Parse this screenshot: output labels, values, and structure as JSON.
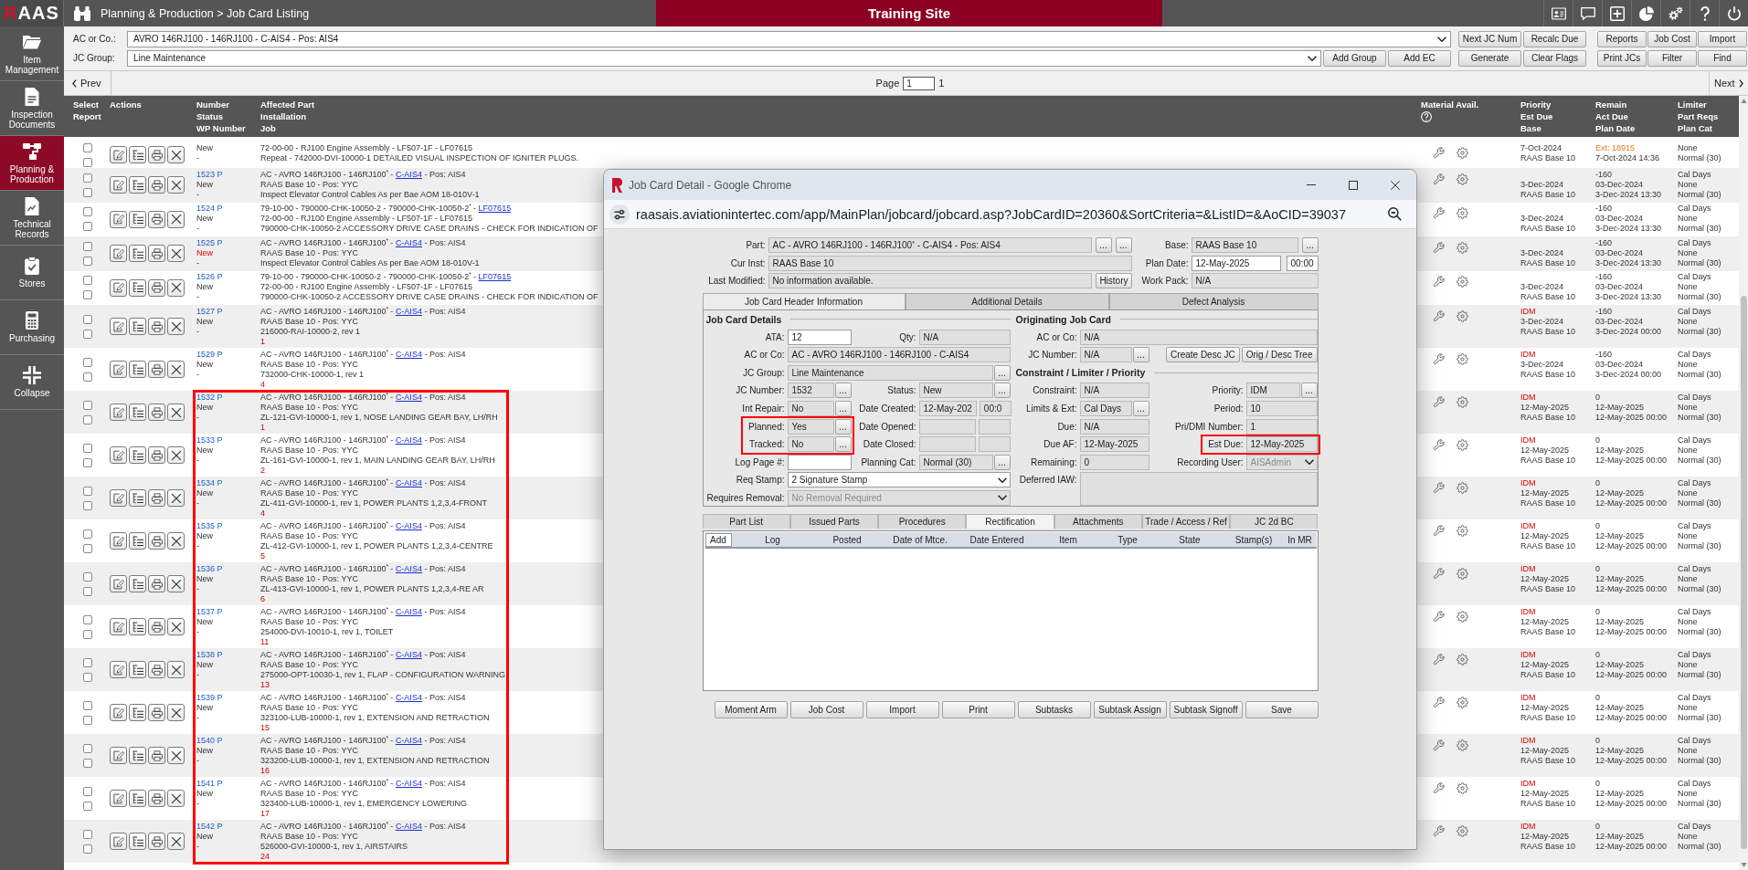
{
  "top_bar": {
    "logo": "RAAS",
    "breadcrumb": "Planning & Production > Job Card Listing",
    "site": "Training Site"
  },
  "sidebar": {
    "items": [
      {
        "label": "Item Management",
        "selected": false
      },
      {
        "label": "Inspection Documents",
        "selected": false
      },
      {
        "label": "Planning & Production",
        "selected": true
      },
      {
        "label": "Technical Records",
        "selected": false
      },
      {
        "label": "Stores",
        "selected": false
      },
      {
        "label": "Purchasing",
        "selected": false
      },
      {
        "label": "Collapse",
        "selected": false
      }
    ]
  },
  "filters": {
    "fields": [
      {
        "label": "AC or Co.:",
        "value": "AVRO 146RJ100 - 146RJ100 - C-AIS4 - Pos: AIS4"
      },
      {
        "label": "JC Group:",
        "value": "Line Maintenance"
      }
    ],
    "group_buttons": [
      "Add Group",
      "Add EC"
    ],
    "button_blocks": [
      [
        "Next JC Num",
        "Recalc Due",
        "Generate",
        "Clear Flags"
      ],
      [
        "Reports",
        "Job Cost",
        "Import",
        "Print JCs",
        "Filter",
        "Find"
      ]
    ]
  },
  "pager": {
    "prev": "Prev",
    "page_label": "Page",
    "page": "1",
    "page_count": "1",
    "next": "Next"
  },
  "table": {
    "columns": [
      {
        "labels": [
          "Select",
          "Report"
        ],
        "help": false
      },
      {
        "labels": [
          "Actions"
        ],
        "help": false
      },
      {
        "labels": [
          "Number",
          "Status",
          "WP Number"
        ],
        "help": false
      },
      {
        "labels": [
          "Affected Part",
          "Installation",
          "Job"
        ],
        "help": false
      },
      {
        "labels": [
          "Material Avail."
        ],
        "help": true
      },
      {
        "labels": [
          "Priority",
          "Est Due",
          "Base"
        ],
        "help": false
      },
      {
        "labels": [
          "Remain",
          "Act Due",
          "Plan Date"
        ],
        "help": false
      },
      {
        "labels": [
          "Limiter",
          "Part Reqs",
          "Plan Cat"
        ],
        "help": false
      }
    ],
    "partial_row": {
      "checks": [
        false,
        false
      ],
      "status": {
        "text": "New",
        "alert": false
      },
      "wp": "-",
      "installation": "72-00-00 - RJ100 Engine Assembly - LF507-1F - LF07615",
      "job": "Repeat - 742000-DVI-10000-1 DETAILED VISUAL INSPECTION OF IGNITER PLUGS.",
      "est_due": "7-Oct-2024",
      "base": "RAAS Base 10",
      "act_due": "Ext: 18915",
      "extended": true,
      "plan_date": "7-Oct-2024 14:36",
      "part_reqs": "None",
      "plan_cat": "Normal (30)"
    },
    "rows": [
      {
        "checks": [
          false,
          false
        ],
        "number": "1523 P",
        "status": {
          "text": "New",
          "alert": false
        },
        "wp": "-",
        "part": [
          {
            "kind": "text",
            "text": "AC - AVRO 146RJ100 - 146RJ100$^{*}$ -"
          },
          {
            "kind": "link",
            "text": "C-AIS4"
          },
          {
            "kind": "text",
            "text": "- Pos: AIS4"
          }
        ],
        "installation": "RAAS Base 10 - Pos: YYC",
        "job": "Inspect Elevator Control Cables As per Bae AOM 18-010V-1",
        "est_due": "3-Dec-2024",
        "base": "RAAS Base 10",
        "remain": "-160",
        "act_due": "03-Dec-2024",
        "extended": false,
        "plan_date": "3-Dec-2024 13:30",
        "limiter": "Cal Days",
        "part_reqs": "None",
        "plan_cat": "Normal (30)",
        "highlighted": false
      },
      {
        "checks": [
          false,
          false
        ],
        "number": "1524 P",
        "status": {
          "text": "New",
          "alert": false
        },
        "wp": "-",
        "part": [
          {
            "kind": "text",
            "text": "79-10-00 - 790000-CHK-10050-2 - 790000-CHK-10050-2$^{*}$ -"
          },
          {
            "kind": "link",
            "text": "LF07615"
          }
        ],
        "installation": "72-00-00 - RJ100 Engine Assembly - LF507-1F - LF07615",
        "job": "790000-CHK-10050-2 ACCESSORY DRIVE CASE DRAINS - CHECK FOR INDICATION OF",
        "est_due": "3-Dec-2024",
        "base": "RAAS Base 10",
        "remain": "-160",
        "act_due": "03-Dec-2024",
        "extended": false,
        "plan_date": "3-Dec-2024 13:30",
        "limiter": "Cal Days",
        "part_reqs": "None",
        "plan_cat": "Normal (30)",
        "highlighted": false
      },
      {
        "checks": [
          false,
          false
        ],
        "number": "1525 P",
        "status": {
          "text": "New",
          "alert": true
        },
        "wp": "-",
        "part": [
          {
            "kind": "text",
            "text": "AC - AVRO 146RJ100 - 146RJ100$^{*}$ -"
          },
          {
            "kind": "link",
            "text": "C-AIS4"
          },
          {
            "kind": "text",
            "text": "- Pos: AIS4"
          }
        ],
        "installation": "RAAS Base 10 - Pos: YYC",
        "job": "Inspect Elevator Control Cables As per Bae AOM 18-010V-1",
        "est_due": "3-Dec-2024",
        "base": "RAAS Base 10",
        "remain": "-160",
        "act_due": "03-Dec-2024",
        "extended": false,
        "plan_date": "3-Dec-2024 13:30",
        "limiter": "Cal Days",
        "part_reqs": "None",
        "plan_cat": "Normal (30)",
        "highlighted": false
      },
      {
        "checks": [
          false,
          false
        ],
        "number": "1526 P",
        "status": {
          "text": "New",
          "alert": false
        },
        "wp": "-",
        "part": [
          {
            "kind": "text",
            "text": "79-10-00 - 790000-CHK-10050-2 - 790000-CHK-10050-2$^{*}$ -"
          },
          {
            "kind": "link",
            "text": "LF07615"
          }
        ],
        "installation": "72-00-00 - RJ100 Engine Assembly - LF507-1F - LF07615",
        "job": "790000-CHK-10050-2 ACCESSORY DRIVE CASE DRAINS - CHECK FOR INDICATION OF",
        "est_due": "3-Dec-2024",
        "base": "RAAS Base 10",
        "remain": "-160",
        "act_due": "03-Dec-2024",
        "extended": false,
        "plan_date": "3-Dec-2024 13:30",
        "limiter": "Cal Days",
        "part_reqs": "None",
        "plan_cat": "Normal (30)",
        "highlighted": false
      },
      {
        "checks": [
          false,
          false
        ],
        "number": "1527 P",
        "status": {
          "text": "New",
          "alert": false
        },
        "wp": "-",
        "part": [
          {
            "kind": "text",
            "text": "AC - AVRO 146RJ100 - 146RJ100$^{*}$ -"
          },
          {
            "kind": "link",
            "text": "C-AIS4"
          },
          {
            "kind": "text",
            "text": "- Pos: AIS4"
          }
        ],
        "installation": "RAAS Base 10 - Pos: YYC",
        "job": "216000-RAI-10000-2, rev 1",
        "seq": "1",
        "priority": "IDM",
        "est_due": "3-Dec-2024",
        "base": "RAAS Base 10",
        "remain": "-160",
        "act_due": "03-Dec-2024",
        "extended": false,
        "plan_date": "3-Dec-2024 00:00",
        "limiter": "Cal Days",
        "part_reqs": "None",
        "plan_cat": "Normal (30)",
        "highlighted": false
      },
      {
        "checks": [
          false,
          false
        ],
        "number": "1529 P",
        "status": {
          "text": "New",
          "alert": false
        },
        "wp": "-",
        "part": [
          {
            "kind": "text",
            "text": "AC - AVRO 146RJ100 - 146RJ100$^{*}$ -"
          },
          {
            "kind": "link",
            "text": "C-AIS4"
          },
          {
            "kind": "text",
            "text": "- Pos: AIS4"
          }
        ],
        "installation": "RAAS Base 10 - Pos: YYC",
        "job": "732000-CHK-10000-1, rev 1",
        "seq": "4",
        "priority": "IDM",
        "est_due": "3-Dec-2024",
        "base": "RAAS Base 10",
        "remain": "-160",
        "act_due": "03-Dec-2024",
        "extended": false,
        "plan_date": "3-Dec-2024 00:00",
        "limiter": "Cal Days",
        "part_reqs": "None",
        "plan_cat": "Normal (30)",
        "highlighted": false
      },
      {
        "checks": [
          false,
          false
        ],
        "number": "1532 P",
        "status": {
          "text": "New",
          "alert": false
        },
        "wp": "-",
        "part": [
          {
            "kind": "text",
            "text": "AC - AVRO 146RJ100 - 146RJ100$^{*}$ -"
          },
          {
            "kind": "link",
            "text": "C-AIS4"
          },
          {
            "kind": "text",
            "text": "- Pos: AIS4"
          }
        ],
        "installation": "RAAS Base 10 - Pos: YYC",
        "job": "ZL-121-GVI-10000-1, rev 1, NOSE LANDING GEAR BAY, LH/RH",
        "seq": "1",
        "priority": "IDM",
        "est_due": "12-May-2025",
        "base": "RAAS Base 10",
        "remain": "0",
        "act_due": "12-May-2025",
        "extended": false,
        "plan_date": "12-May-2025 00:00",
        "limiter": "Cal Days",
        "part_reqs": "None",
        "plan_cat": "Normal (30)",
        "highlighted": true
      },
      {
        "checks": [
          false,
          false
        ],
        "number": "1533 P",
        "status": {
          "text": "New",
          "alert": false
        },
        "wp": "-",
        "part": [
          {
            "kind": "text",
            "text": "AC - AVRO 146RJ100 - 146RJ100$^{*}$ -"
          },
          {
            "kind": "link",
            "text": "C-AIS4"
          },
          {
            "kind": "text",
            "text": "- Pos: AIS4"
          }
        ],
        "installation": "RAAS Base 10 - Pos: YYC",
        "job": "ZL-161-GVI-10000-1, rev 1, MAIN LANDING GEAR BAY, LH/RH",
        "seq": "2",
        "priority": "IDM",
        "est_due": "12-May-2025",
        "base": "RAAS Base 10",
        "remain": "0",
        "act_due": "12-May-2025",
        "extended": false,
        "plan_date": "12-May-2025 00:00",
        "limiter": "Cal Days",
        "part_reqs": "None",
        "plan_cat": "Normal (30)",
        "highlighted": true
      },
      {
        "checks": [
          false,
          false
        ],
        "number": "1534 P",
        "status": {
          "text": "New",
          "alert": false
        },
        "wp": "-",
        "part": [
          {
            "kind": "text",
            "text": "AC - AVRO 146RJ100 - 146RJ100$^{*}$ -"
          },
          {
            "kind": "link",
            "text": "C-AIS4"
          },
          {
            "kind": "text",
            "text": "- Pos: AIS4"
          }
        ],
        "installation": "RAAS Base 10 - Pos: YYC",
        "job": "ZL-411-GVI-10000-1, rev 1, POWER PLANTS 1,2,3,4-FRONT",
        "seq": "4",
        "priority": "IDM",
        "est_due": "12-May-2025",
        "base": "RAAS Base 10",
        "remain": "0",
        "act_due": "12-May-2025",
        "extended": false,
        "plan_date": "12-May-2025 00:00",
        "limiter": "Cal Days",
        "part_reqs": "None",
        "plan_cat": "Normal (30)",
        "highlighted": true
      },
      {
        "checks": [
          false,
          false
        ],
        "number": "1535 P",
        "status": {
          "text": "New",
          "alert": false
        },
        "wp": "-",
        "part": [
          {
            "kind": "text",
            "text": "AC - AVRO 146RJ100 - 146RJ100$^{*}$ -"
          },
          {
            "kind": "link",
            "text": "C-AIS4"
          },
          {
            "kind": "text",
            "text": "- Pos: AIS4"
          }
        ],
        "installation": "RAAS Base 10 - Pos: YYC",
        "job": "ZL-412-GVI-10000-1, rev 1, POWER PLANTS 1,2,3,4-CENTRE",
        "seq": "5",
        "priority": "IDM",
        "est_due": "12-May-2025",
        "base": "RAAS Base 10",
        "remain": "0",
        "act_due": "12-May-2025",
        "extended": false,
        "plan_date": "12-May-2025 00:00",
        "limiter": "Cal Days",
        "part_reqs": "None",
        "plan_cat": "Normal (30)",
        "highlighted": true
      },
      {
        "checks": [
          false,
          false
        ],
        "number": "1536 P",
        "status": {
          "text": "New",
          "alert": false
        },
        "wp": "-",
        "part": [
          {
            "kind": "text",
            "text": "AC - AVRO 146RJ100 - 146RJ100$^{*}$ -"
          },
          {
            "kind": "link",
            "text": "C-AIS4"
          },
          {
            "kind": "text",
            "text": "- Pos: AIS4"
          }
        ],
        "installation": "RAAS Base 10 - Pos: YYC",
        "job": "ZL-413-GVI-10000-1, rev 1, POWER PLANTS 1,2,3,4-RE AR",
        "seq": "6",
        "priority": "IDM",
        "est_due": "12-May-2025",
        "base": "RAAS Base 10",
        "remain": "0",
        "act_due": "12-May-2025",
        "extended": false,
        "plan_date": "12-May-2025 00:00",
        "limiter": "Cal Days",
        "part_reqs": "None",
        "plan_cat": "Normal (30)",
        "highlighted": true
      },
      {
        "checks": [
          false,
          false
        ],
        "number": "1537 P",
        "status": {
          "text": "New",
          "alert": false
        },
        "wp": "-",
        "part": [
          {
            "kind": "text",
            "text": "AC - AVRO 146RJ100 - 146RJ100$^{*}$ -"
          },
          {
            "kind": "link",
            "text": "C-AIS4"
          },
          {
            "kind": "text",
            "text": "- Pos: AIS4"
          }
        ],
        "installation": "RAAS Base 10 - Pos: YYC",
        "job": "254000-DVI-10010-1, rev 1, TOILET",
        "seq": "11",
        "priority": "IDM",
        "est_due": "12-May-2025",
        "base": "RAAS Base 10",
        "remain": "0",
        "act_due": "12-May-2025",
        "extended": false,
        "plan_date": "12-May-2025 00:00",
        "limiter": "Cal Days",
        "part_reqs": "None",
        "plan_cat": "Normal (30)",
        "highlighted": true
      },
      {
        "checks": [
          false,
          false
        ],
        "number": "1538 P",
        "status": {
          "text": "New",
          "alert": false
        },
        "wp": "-",
        "part": [
          {
            "kind": "text",
            "text": "AC - AVRO 146RJ100 - 146RJ100$^{*}$ -"
          },
          {
            "kind": "link",
            "text": "C-AIS4"
          },
          {
            "kind": "text",
            "text": "- Pos: AIS4"
          }
        ],
        "installation": "RAAS Base 10 - Pos: YYC",
        "job": "275000-OPT-10030-1, rev 1, FLAP - CONFIGURATION WARNING",
        "seq": "13",
        "priority": "IDM",
        "est_due": "12-May-2025",
        "base": "RAAS Base 10",
        "remain": "0",
        "act_due": "12-May-2025",
        "extended": false,
        "plan_date": "12-May-2025 00:00",
        "limiter": "Cal Days",
        "part_reqs": "None",
        "plan_cat": "Normal (30)",
        "highlighted": true
      },
      {
        "checks": [
          false,
          false
        ],
        "number": "1539 P",
        "status": {
          "text": "New",
          "alert": false
        },
        "wp": "-",
        "part": [
          {
            "kind": "text",
            "text": "AC - AVRO 146RJ100 - 146RJ100$^{*}$ -"
          },
          {
            "kind": "link",
            "text": "C-AIS4"
          },
          {
            "kind": "text",
            "text": "- Pos: AIS4"
          }
        ],
        "installation": "RAAS Base 10 - Pos: YYC",
        "job": "323100-LUB-10000-1, rev 1, EXTENSION AND RETRACTION",
        "seq": "15",
        "priority": "IDM",
        "est_due": "12-May-2025",
        "base": "RAAS Base 10",
        "remain": "0",
        "act_due": "12-May-2025",
        "extended": false,
        "plan_date": "12-May-2025 00:00",
        "limiter": "Cal Days",
        "part_reqs": "None",
        "plan_cat": "Normal (30)",
        "highlighted": true
      },
      {
        "checks": [
          false,
          false
        ],
        "number": "1540 P",
        "status": {
          "text": "New",
          "alert": false
        },
        "wp": "-",
        "part": [
          {
            "kind": "text",
            "text": "AC - AVRO 146RJ100 - 146RJ100$^{*}$ -"
          },
          {
            "kind": "link",
            "text": "C-AIS4"
          },
          {
            "kind": "text",
            "text": "- Pos: AIS4"
          }
        ],
        "installation": "RAAS Base 10 - Pos: YYC",
        "job": "323200-LUB-10000-1, rev 1, EXTENSION AND RETRACTION",
        "seq": "16",
        "priority": "IDM",
        "est_due": "12-May-2025",
        "base": "RAAS Base 10",
        "remain": "0",
        "act_due": "12-May-2025",
        "extended": false,
        "plan_date": "12-May-2025 00:00",
        "limiter": "Cal Days",
        "part_reqs": "None",
        "plan_cat": "Normal (30)",
        "highlighted": true
      },
      {
        "checks": [
          false,
          false
        ],
        "number": "1541 P",
        "status": {
          "text": "New",
          "alert": false
        },
        "wp": "-",
        "part": [
          {
            "kind": "text",
            "text": "AC - AVRO 146RJ100 - 146RJ100$^{*}$ -"
          },
          {
            "kind": "link",
            "text": "C-AIS4"
          },
          {
            "kind": "text",
            "text": "- Pos: AIS4"
          }
        ],
        "installation": "RAAS Base 10 - Pos: YYC",
        "job": "323400-LUB-10000-1, rev 1, EMERGENCY LOWERING",
        "seq": "17",
        "priority": "IDM",
        "est_due": "12-May-2025",
        "base": "RAAS Base 10",
        "remain": "0",
        "act_due": "12-May-2025",
        "extended": false,
        "plan_date": "12-May-2025 00:00",
        "limiter": "Cal Days",
        "part_reqs": "None",
        "plan_cat": "Normal (30)",
        "highlighted": true
      },
      {
        "checks": [
          false,
          false
        ],
        "number": "1542 P",
        "status": {
          "text": "New",
          "alert": false
        },
        "wp": "-",
        "part": [
          {
            "kind": "text",
            "text": "AC - AVRO 146RJ100 - 146RJ100$^{*}$ -"
          },
          {
            "kind": "link",
            "text": "C-AIS4"
          },
          {
            "kind": "text",
            "text": "- Pos: AIS4"
          }
        ],
        "installation": "RAAS Base 10 - Pos: YYC",
        "job": "526000-GVI-10000-1, rev 1, AIRSTAIRS",
        "seq": "24",
        "priority": "IDM",
        "est_due": "12-May-2025",
        "base": "RAAS Base 10",
        "remain": "0",
        "act_due": "12-May-2025",
        "extended": false,
        "plan_date": "12-May-2025 00:00",
        "limiter": "Cal Days",
        "part_reqs": "None",
        "plan_cat": "Normal (30)",
        "highlighted": true
      }
    ]
  },
  "dialog": {
    "title": "Job Card Detail - Google Chrome",
    "url": "raasais.aviationintertec.com/app/MainPlan/jobcard/jobcard.asp?JobCardID=20360&SortCriteria=&ListID=&AoCID=39037",
    "header": {
      "left": [
        {
          "label": "Part:",
          "kind": "readonly",
          "value": "AC - AVRO 146RJ100 - 146RJ100$^{*}$ - C-AIS4 - Pos: AIS4",
          "lookups": [
            "...",
            "..."
          ]
        },
        {
          "label": "Cur Inst:",
          "kind": "readonly",
          "value": "RAAS Base 10"
        },
        {
          "label": "Last Modified:",
          "kind": "readonly",
          "value": "No information available.",
          "action": "History"
        }
      ],
      "right": [
        {
          "label": "Base:",
          "kind": "readonly",
          "value": "RAAS Base 10",
          "lookups": [
            "..."
          ]
        },
        {
          "label": "Plan Date:",
          "kind": "input-datetime",
          "value": "12-May-2025",
          "time": "00:00"
        },
        {
          "label": "Work Pack:",
          "kind": "readonly",
          "value": "N/A"
        }
      ]
    },
    "tabs": [
      {
        "label": "Job Card Header Information",
        "selected": true
      },
      {
        "label": "Additional Details",
        "selected": false
      },
      {
        "label": "Defect Analysis",
        "selected": false
      }
    ],
    "panel": {
      "columns": [
        {
          "items": [
            {
              "kind": "heading",
              "text": "Job Card Details"
            },
            {
              "kind": "row",
              "fields": [
                {
                  "label": "ATA:",
                  "kind": "input",
                  "value": "12",
                  "highlighted": false
                },
                {
                  "label": "Qty:",
                  "kind": "readonly",
                  "value": "N/A",
                  "highlighted": false
                }
              ]
            },
            {
              "kind": "row",
              "fields": [
                {
                  "label": "AC or Co:",
                  "kind": "readonly",
                  "value": "AC - AVRO 146RJ100 - 146RJ100 - C-AIS4",
                  "highlighted": false
                }
              ]
            },
            {
              "kind": "row",
              "fields": [
                {
                  "label": "JC Group:",
                  "kind": "readonly",
                  "value": "Line Maintenance",
                  "lookups": [
                    "..."
                  ],
                  "highlighted": false
                }
              ]
            },
            {
              "kind": "row",
              "fields": [
                {
                  "label": "JC Number:",
                  "kind": "readonly",
                  "value": "1532",
                  "lookups": [
                    "..."
                  ],
                  "highlighted": false
                },
                {
                  "label": "Status:",
                  "kind": "readonly",
                  "value": "New",
                  "lookups": [
                    "..."
                  ],
                  "highlighted": false
                }
              ]
            },
            {
              "kind": "row",
              "fields": [
                {
                  "label": "Int Repair:",
                  "kind": "readonly",
                  "value": "No",
                  "lookups": [
                    "..."
                  ],
                  "highlighted": false
                },
                {
                  "label": "Date Created:",
                  "kind": "readonly-datetime",
                  "value": "12-May-202",
                  "time": "00:0",
                  "highlighted": false
                }
              ]
            },
            {
              "kind": "row",
              "fields": [
                {
                  "label": "Planned:",
                  "kind": "readonly",
                  "value": "Yes",
                  "lookups": [
                    "..."
                  ],
                  "highlighted": true
                },
                {
                  "label": "Date Opened:",
                  "kind": "readonly-datetime",
                  "highlighted": false
                }
              ]
            },
            {
              "kind": "row",
              "fields": [
                {
                  "label": "Tracked:",
                  "kind": "readonly",
                  "value": "No",
                  "lookups": [
                    "..."
                  ],
                  "highlighted": true
                },
                {
                  "label": "Date Closed:",
                  "kind": "readonly-datetime",
                  "highlighted": false
                }
              ]
            },
            {
              "kind": "row",
              "fields": [
                {
                  "label": "Log Page #:",
                  "kind": "input",
                  "highlighted": false
                },
                {
                  "label": "Planning Cat:",
                  "kind": "readonly",
                  "value": "Normal (30)",
                  "lookups": [
                    "..."
                  ],
                  "highlighted": false
                }
              ]
            },
            {
              "kind": "row",
              "fields": [
                {
                  "label": "Req Stamp:",
                  "kind": "select",
                  "value": "2 Signature Stamp",
                  "highlighted": false
                }
              ]
            },
            {
              "kind": "row",
              "fields": [
                {
                  "label": "Requires Removal:",
                  "kind": "disabled-select",
                  "value": "No Removal Required",
                  "highlighted": false
                }
              ]
            }
          ]
        },
        {
          "items": [
            {
              "kind": "heading",
              "text": "Originating Job Card"
            },
            {
              "kind": "row",
              "fields": [
                {
                  "label": "AC or Co:",
                  "kind": "readonly",
                  "value": "N/A",
                  "highlighted": false
                }
              ]
            },
            {
              "kind": "row",
              "fields": [
                {
                  "label": "JC Number:",
                  "kind": "readonly",
                  "value": "N/A",
                  "lookups": [
                    "..."
                  ],
                  "highlighted": false
                }
              ],
              "buttons": [
                "Create Desc JC",
                "Orig / Desc Tree"
              ]
            },
            {
              "kind": "heading",
              "text": "Constraint / Limiter / Priority"
            },
            {
              "kind": "row",
              "fields": [
                {
                  "label": "Constraint:",
                  "kind": "readonly",
                  "value": "N/A",
                  "highlighted": false
                },
                {
                  "label": "Priority:",
                  "kind": "readonly",
                  "value": "IDM",
                  "lookups": [
                    "..."
                  ],
                  "highlighted": false
                }
              ]
            },
            {
              "kind": "row",
              "fields": [
                {
                  "label": "Limits & Ext:",
                  "kind": "readonly",
                  "value": "Cal Days",
                  "lookups": [
                    "..."
                  ],
                  "highlighted": false
                },
                {
                  "label": "Period:",
                  "kind": "readonly",
                  "value": "10",
                  "highlighted": false
                }
              ]
            },
            {
              "kind": "row",
              "fields": [
                {
                  "label": "Due:",
                  "kind": "readonly",
                  "value": "N/A",
                  "highlighted": false
                },
                {
                  "label": "Pri/DMI Number:",
                  "kind": "readonly",
                  "value": "1",
                  "highlighted": false
                }
              ]
            },
            {
              "kind": "row",
              "fields": [
                {
                  "label": "Due AF:",
                  "kind": "readonly",
                  "value": "12-May-2025",
                  "highlighted": false
                },
                {
                  "label": "Est Due:",
                  "kind": "readonly",
                  "value": "12-May-2025",
                  "highlighted": true
                }
              ]
            },
            {
              "kind": "row",
              "fields": [
                {
                  "label": "Remaining:",
                  "kind": "readonly",
                  "value": "0",
                  "highlighted": false
                },
                {
                  "label": "Recording User:",
                  "kind": "disabled-select",
                  "value": "AISAdmin",
                  "highlighted": false
                }
              ]
            },
            {
              "kind": "row",
              "fields": [
                {
                  "label": "Deferred IAW:",
                  "kind": "textarea",
                  "highlighted": false
                }
              ]
            }
          ]
        }
      ]
    },
    "lower_tabs": [
      {
        "label": "Part List",
        "selected": false
      },
      {
        "label": "Issued Parts",
        "selected": false
      },
      {
        "label": "Procedures",
        "selected": false
      },
      {
        "label": "Rectification",
        "selected": true
      },
      {
        "label": "Attachments",
        "selected": false
      },
      {
        "label": "Trade / Access / Ref",
        "selected": false
      },
      {
        "label": "JC 2d BC",
        "selected": false
      }
    ],
    "log_grid": {
      "add": "Add",
      "columns": [
        "Log",
        "Posted",
        "Date of Mtce.",
        "Date Entered",
        "Item",
        "Type",
        "State",
        "Stamp(s)",
        "In MR"
      ]
    },
    "buttons": [
      "Moment Arm",
      "Job Cost",
      "Import",
      "Print",
      "Subtasks",
      "Subtask Assign",
      "Subtask Signoff",
      "Save"
    ]
  }
}
